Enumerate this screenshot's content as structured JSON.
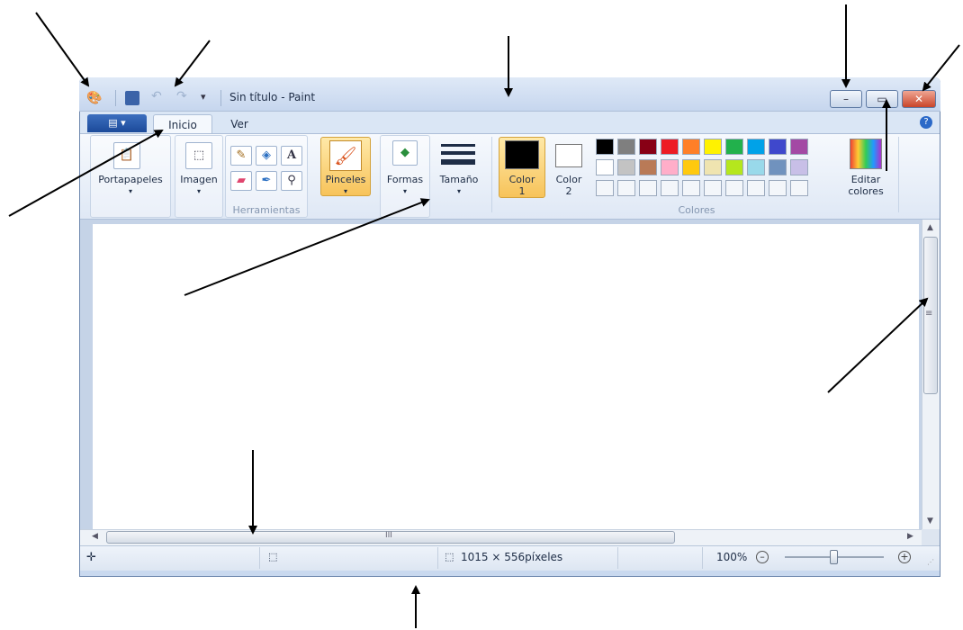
{
  "window": {
    "title": "Sin título - Paint",
    "quick_access_more": "▾"
  },
  "tabs": [
    {
      "label": "Inicio",
      "active": true
    },
    {
      "label": "Ver",
      "active": false
    }
  ],
  "ribbon": {
    "clipboard_label": "Portapapeles",
    "image_label": "Imagen",
    "tools_group_label": "Herramientas",
    "brushes_label": "Pinceles",
    "shapes_label": "Formas",
    "size_label": "Tamaño",
    "color1_label": "Color",
    "color1_num": "1",
    "color2_label": "Color",
    "color2_num": "2",
    "edit_colors_label_1": "Editar",
    "edit_colors_label_2": "colores",
    "colors_group_label": "Colores",
    "palette_row1": [
      "#000000",
      "#7f7f7f",
      "#880015",
      "#ed1c24",
      "#ff7f27",
      "#fff200",
      "#22b14c",
      "#00a2e8",
      "#3f48cc",
      "#a349a4"
    ],
    "palette_row2": [
      "#ffffff",
      "#c3c3c3",
      "#b97a57",
      "#ffaec9",
      "#ffc90e",
      "#efe4b0",
      "#b5e61d",
      "#99d9ea",
      "#7092be",
      "#c8bfe7"
    ],
    "color1": "#000000",
    "color2": "#ffffff"
  },
  "statusbar": {
    "image_size": "1015 × 556píxeles",
    "zoom": "100%"
  },
  "scroll": {
    "hgrip": "III",
    "vgrip": "≡"
  }
}
